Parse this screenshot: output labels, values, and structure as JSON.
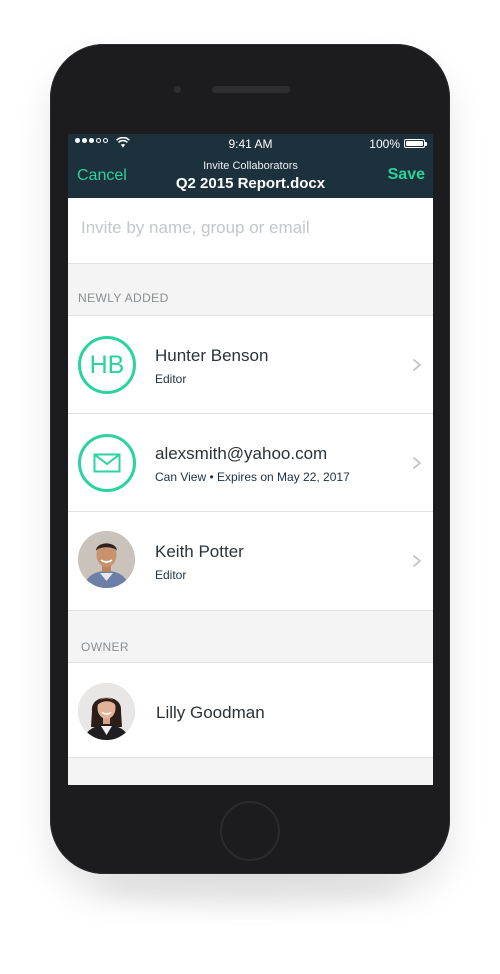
{
  "status_bar": {
    "time": "9:41 AM",
    "battery": "100%"
  },
  "nav": {
    "cancel_label": "Cancel",
    "subtitle": "Invite Collaborators",
    "title": "Q2 2015 Report.docx",
    "save_label": "Save"
  },
  "search": {
    "placeholder": "Invite by name, group or email",
    "value": ""
  },
  "sections": {
    "newly_added": {
      "header": "NEWLY ADDED",
      "items": [
        {
          "initials": "HB",
          "name": "Hunter Benson",
          "role": "Editor",
          "icon": "initials-avatar"
        },
        {
          "name": "alexsmith@yahoo.com",
          "role": "Can View • Expires on May 22, 2017",
          "icon": "mail-icon"
        },
        {
          "name": "Keith Potter",
          "role": "Editor",
          "icon": "photo-avatar"
        }
      ]
    },
    "owner": {
      "header": "OWNER",
      "items": [
        {
          "name": "Lilly Goodman",
          "icon": "photo-avatar"
        }
      ]
    }
  },
  "colors": {
    "accent": "#2ad39c",
    "nav_bg": "#1d313d",
    "phone_body": "#1c1c1e"
  }
}
